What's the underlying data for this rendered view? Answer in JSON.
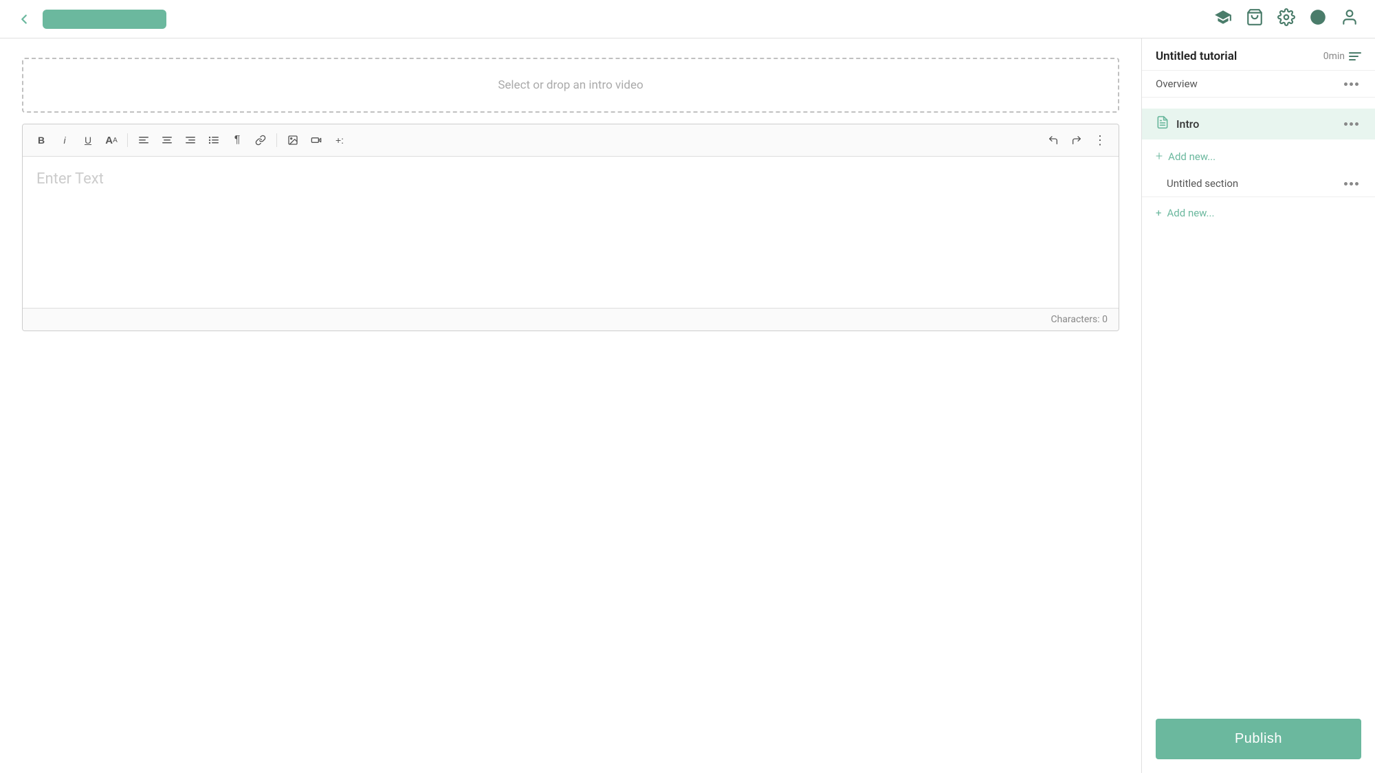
{
  "topbar": {
    "back_icon": "←",
    "nav_icons": [
      "graduation-cap",
      "bag",
      "gear",
      "circle",
      "user"
    ],
    "pill_color": "#6bb89e"
  },
  "editor": {
    "video_drop_label": "Select or drop an intro video",
    "text_placeholder": "Enter Text",
    "char_count_label": "Characters: 0",
    "toolbar": {
      "bold": "B",
      "italic": "i",
      "underline": "U",
      "font_size": "A",
      "align_left": "≡",
      "align_center": "≡",
      "align_right": "≡",
      "list": "≡",
      "paragraph": "¶",
      "link": "🔗",
      "image": "🖼",
      "video": "▭",
      "plus": "+:",
      "undo": "↩",
      "redo": "↪",
      "more": "⋮"
    }
  },
  "sidebar": {
    "tutorial_title": "Untitled tutorial",
    "duration": "0min",
    "overview_label": "Overview",
    "intro_label": "Intro",
    "add_new_label": "Add new...",
    "untitled_section_label": "Untitled section",
    "add_new_2_label": "Add new...",
    "publish_label": "Publish"
  }
}
